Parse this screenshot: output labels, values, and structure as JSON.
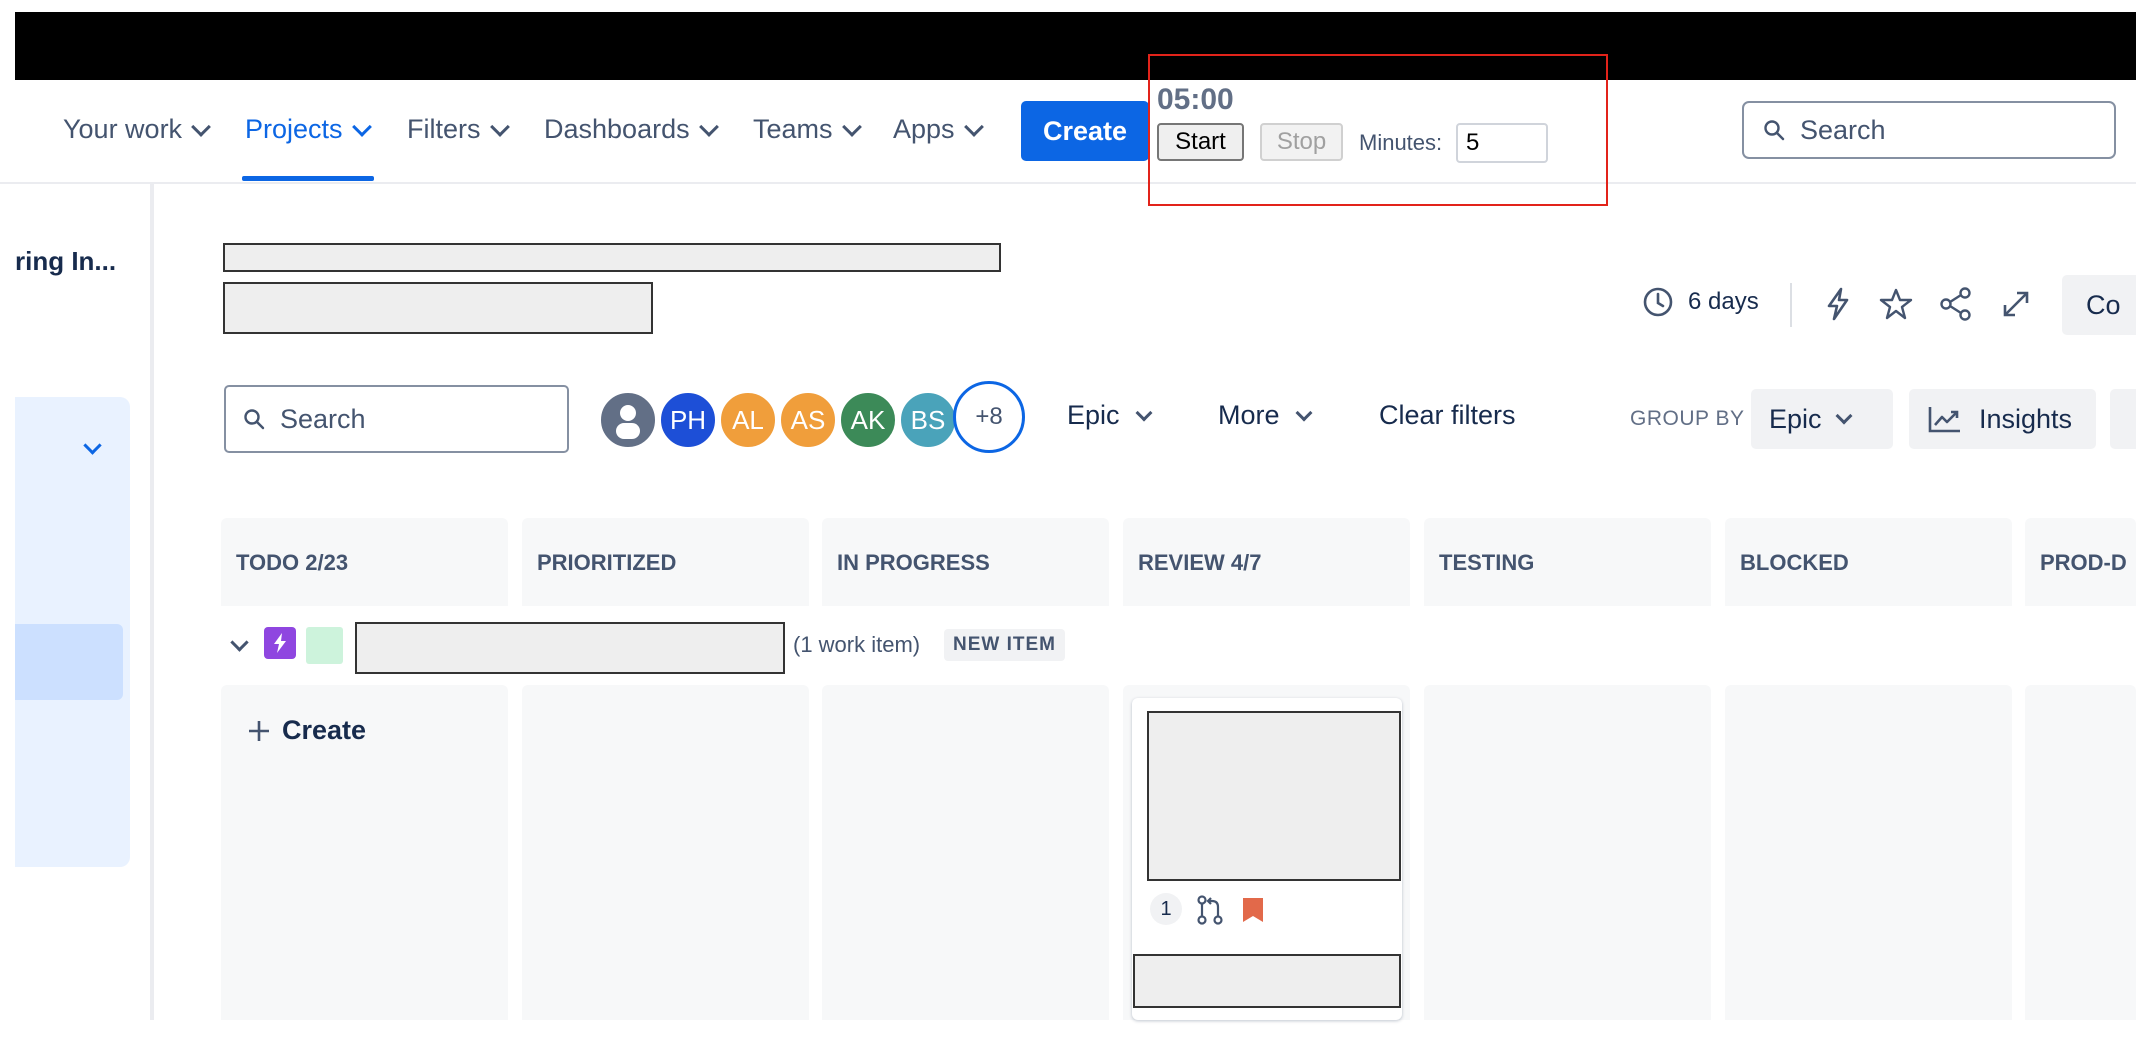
{
  "nav": {
    "items": [
      {
        "label": "Your work"
      },
      {
        "label": "Projects"
      },
      {
        "label": "Filters"
      },
      {
        "label": "Dashboards"
      },
      {
        "label": "Teams"
      },
      {
        "label": "Apps"
      }
    ],
    "create_label": "Create",
    "search_placeholder": "Search"
  },
  "timer": {
    "time": "05:00",
    "start_label": "Start",
    "stop_label": "Stop",
    "minutes_label": "Minutes:",
    "minutes_value": "5"
  },
  "sidebar": {
    "title": "ring In..."
  },
  "header": {
    "days_label": "6 days",
    "co_button_label": "Co"
  },
  "filters": {
    "search_placeholder": "Search",
    "avatars": [
      {
        "initials": "",
        "color": "#626f86"
      },
      {
        "initials": "PH",
        "color": "#1d4fd7"
      },
      {
        "initials": "AL",
        "color": "#f09e3b"
      },
      {
        "initials": "AS",
        "color": "#f09e3b"
      },
      {
        "initials": "AK",
        "color": "#3c8a58"
      },
      {
        "initials": "BS",
        "color": "#4aa3ba"
      }
    ],
    "more_avatars": "+8",
    "epic_label": "Epic",
    "more_label": "More",
    "clear_label": "Clear filters",
    "group_by_label": "GROUP BY",
    "group_by_value": "Epic",
    "insights_label": "Insights"
  },
  "columns": [
    {
      "title": "TODO 2/23"
    },
    {
      "title": "PRIORITIZED"
    },
    {
      "title": "IN PROGRESS"
    },
    {
      "title": "REVIEW 4/7"
    },
    {
      "title": "TESTING"
    },
    {
      "title": "BLOCKED"
    },
    {
      "title": "PROD-D"
    }
  ],
  "swimlane": {
    "count_label": "(1 work item)",
    "badge": "NEW ITEM",
    "create_label": "Create"
  },
  "card": {
    "count": "1"
  },
  "colors": {
    "accent": "#0c66e4",
    "timer_border": "#e2231a",
    "epic_purple": "#8f46e0",
    "priority_orange": "#e2694a"
  }
}
